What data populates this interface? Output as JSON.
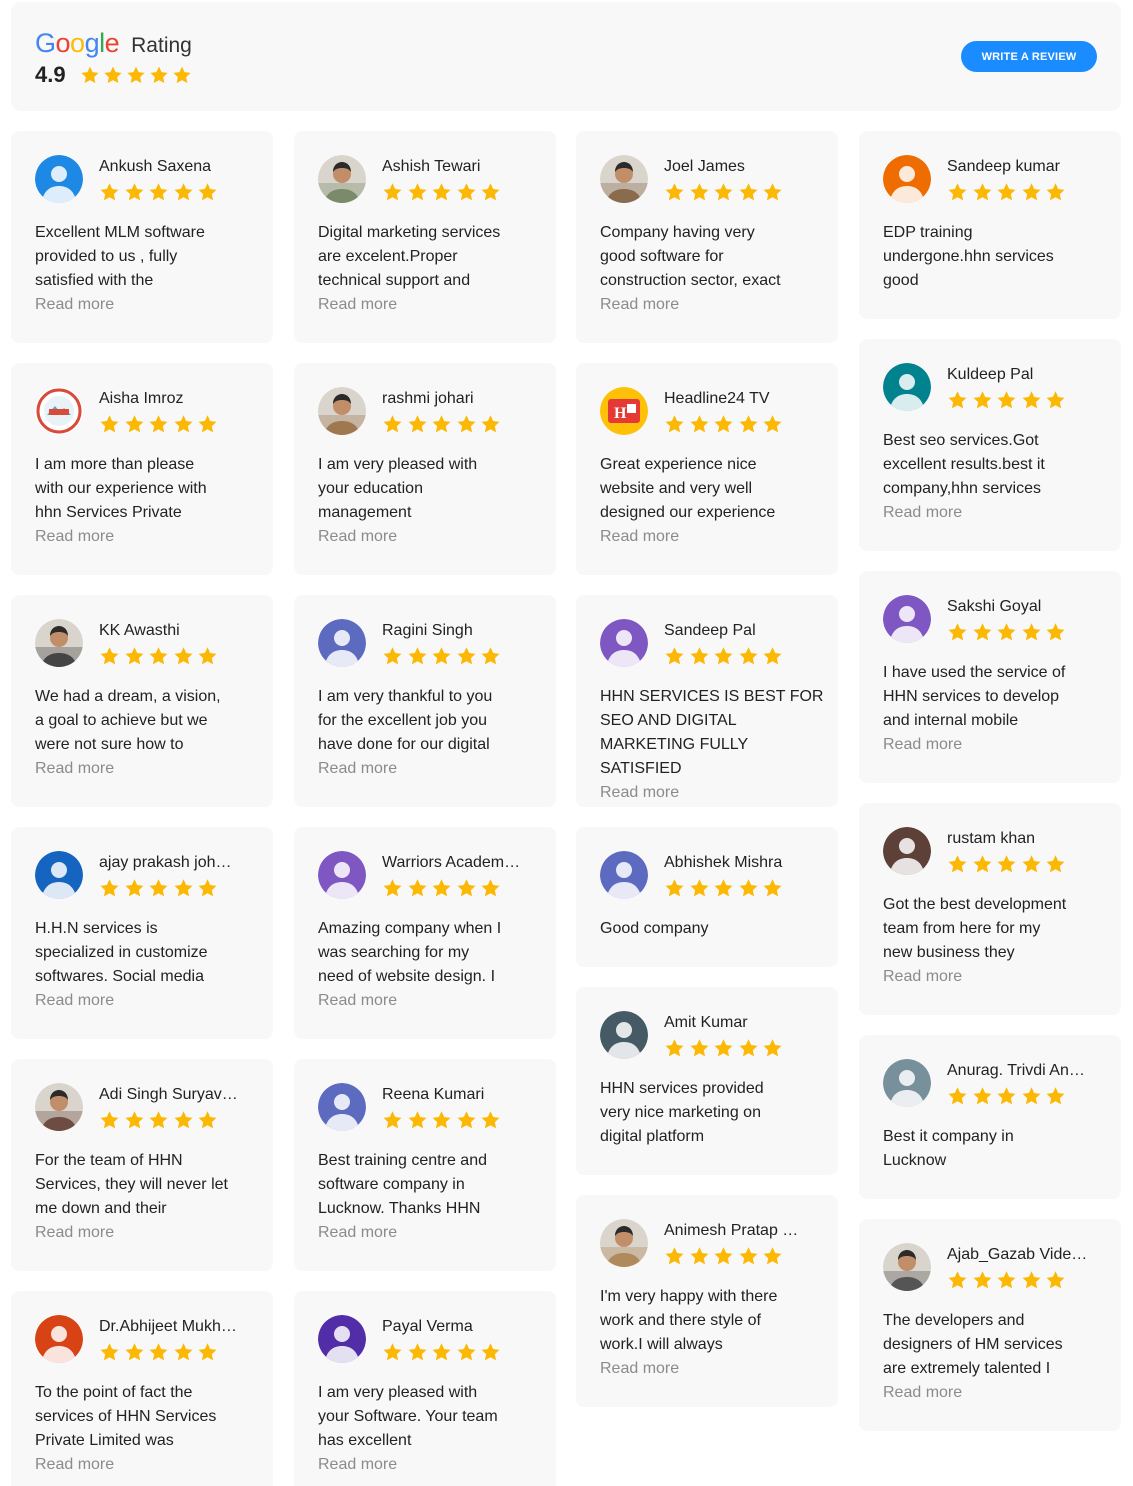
{
  "header": {
    "brand_letters": [
      "G",
      "o",
      "o",
      "g",
      "l",
      "e"
    ],
    "brand_colors": [
      "#4285F4",
      "#EA4335",
      "#FBBC05",
      "#4285F4",
      "#34A853",
      "#EA4335"
    ],
    "rating_label": "Rating",
    "score": "4.9",
    "stars": 5,
    "write_review_label": "WRITE A REVIEW"
  },
  "colors": {
    "star": "#FBB805",
    "button": "#1a8cff",
    "read_more": "#8b8b8b",
    "card_bg": "#f8f8f8"
  },
  "read_more_label": "Read more",
  "columns": [
    [
      {
        "name": "Ankush Saxena",
        "avatar": "default",
        "color": "#1E88E5",
        "stars": 5,
        "lines": [
          "Excellent MLM software",
          "provided to us , fully",
          "satisfied with the"
        ],
        "read_more": true
      },
      {
        "name": "Aisha Imroz",
        "avatar": "logo-red",
        "color": "#d84a3a",
        "stars": 5,
        "lines": [
          "I am more than please",
          "with our experience with",
          "hhn Services Private"
        ],
        "read_more": true
      },
      {
        "name": "KK Awasthi",
        "avatar": "photo-person",
        "color": "#444",
        "stars": 5,
        "lines": [
          "We had a dream, a vision,",
          "a goal to achieve but we",
          "were not sure how to"
        ],
        "read_more": true
      },
      {
        "name": "ajay prakash joh…",
        "avatar": "default",
        "color": "#1565C0",
        "stars": 5,
        "lines": [
          "H.H.N services is",
          "specialized in customize",
          "softwares. Social media"
        ],
        "read_more": true
      },
      {
        "name": "Adi Singh Suryav…",
        "avatar": "photo-person",
        "color": "#6d4c41",
        "stars": 5,
        "lines": [
          "For the team of HHN",
          "Services, they will never let",
          "me down and their"
        ],
        "read_more": true
      },
      {
        "name": "Dr.Abhijeet Mukh…",
        "avatar": "default",
        "color": "#D84315",
        "stars": 5,
        "lines": [
          "To the point of fact the",
          "services of HHN Services",
          "Private Limited was"
        ],
        "read_more": true
      }
    ],
    [
      {
        "name": "Ashish Tewari",
        "avatar": "photo-person",
        "color": "#7b8a6a",
        "stars": 5,
        "lines": [
          "Digital marketing services",
          "are excelent.Proper",
          "technical support and"
        ],
        "read_more": true
      },
      {
        "name": "rashmi johari",
        "avatar": "photo-person",
        "color": "#a0784f",
        "stars": 5,
        "lines": [
          "I am very pleased with",
          "your education",
          "management"
        ],
        "read_more": true
      },
      {
        "name": "Ragini Singh",
        "avatar": "default",
        "color": "#5C6BC0",
        "stars": 5,
        "lines": [
          "I am very thankful to you",
          "for the excellent job you",
          "have done for our digital"
        ],
        "read_more": true
      },
      {
        "name": "Warriors Academ…",
        "avatar": "default",
        "color": "#7E57C2",
        "stars": 5,
        "lines": [
          "Amazing company when I",
          "was searching for my",
          "need of website design. I"
        ],
        "read_more": true
      },
      {
        "name": "Reena Kumari",
        "avatar": "default",
        "color": "#5C6BC0",
        "stars": 5,
        "lines": [
          "Best training centre and",
          "software company in",
          "Lucknow. Thanks HHN"
        ],
        "read_more": true
      },
      {
        "name": "Payal Verma",
        "avatar": "default",
        "color": "#512DA8",
        "stars": 5,
        "lines": [
          "I am very pleased with",
          "your Software. Your team",
          "has excellent"
        ],
        "read_more": true
      }
    ],
    [
      {
        "name": "Joel James",
        "avatar": "photo-person",
        "color": "#8a6b4e",
        "stars": 5,
        "lines": [
          "Company having very",
          "good software for",
          "construction sector, exact"
        ],
        "read_more": true
      },
      {
        "name": "Headline24 TV",
        "avatar": "logo-h24",
        "color": "#e53935",
        "stars": 5,
        "lines": [
          "Great experience nice",
          "website and very well",
          "designed our experience"
        ],
        "read_more": true
      },
      {
        "name": "Sandeep Pal",
        "avatar": "default",
        "color": "#7E57C2",
        "stars": 5,
        "lines": [
          "HHN SERVICES IS BEST FOR",
          "SEO AND DIGITAL",
          "MARKETING FULLY SATISFIED"
        ],
        "read_more": true
      },
      {
        "name": "Abhishek Mishra",
        "avatar": "default",
        "color": "#5C6BC0",
        "stars": 5,
        "lines": [
          "Good company"
        ],
        "read_more": false
      },
      {
        "name": "Amit Kumar",
        "avatar": "default",
        "color": "#455A64",
        "stars": 5,
        "lines": [
          "HHN services provided",
          "very nice marketing on",
          "digital platform"
        ],
        "read_more": false
      },
      {
        "name": "Animesh Pratap …",
        "avatar": "photo-person",
        "color": "#b08a5a",
        "stars": 5,
        "lines": [
          "I'm very happy with there",
          "work and there style of",
          "work.I will always"
        ],
        "read_more": true
      }
    ],
    [
      {
        "name": "Sandeep kumar",
        "avatar": "default",
        "color": "#EF6C00",
        "stars": 5,
        "lines": [
          "EDP training",
          "undergone.hhn services",
          "good"
        ],
        "read_more": false
      },
      {
        "name": "Kuldeep Pal",
        "avatar": "default",
        "color": "#00838F",
        "stars": 5,
        "lines": [
          "Best seo services.Got",
          "excellent results.best it",
          "company,hhn services"
        ],
        "read_more": true
      },
      {
        "name": "Sakshi Goyal",
        "avatar": "default",
        "color": "#7E57C2",
        "stars": 5,
        "lines": [
          "I have used the service of",
          "HHN services to develop",
          "and internal mobile"
        ],
        "read_more": true
      },
      {
        "name": "rustam khan",
        "avatar": "default",
        "color": "#5D4037",
        "stars": 5,
        "lines": [
          "Got the best development",
          "team from here for my",
          "new business they"
        ],
        "read_more": true
      },
      {
        "name": "Anurag. Trivdi An…",
        "avatar": "default",
        "color": "#78909C",
        "stars": 5,
        "lines": [
          "Best it company in",
          "Lucknow"
        ],
        "read_more": false
      },
      {
        "name": "Ajab_Gazab Vide…",
        "avatar": "photo-person",
        "color": "#555",
        "stars": 5,
        "lines": [
          "The developers and",
          "designers of HM services",
          "are extremely talented I"
        ],
        "read_more": true
      }
    ]
  ]
}
